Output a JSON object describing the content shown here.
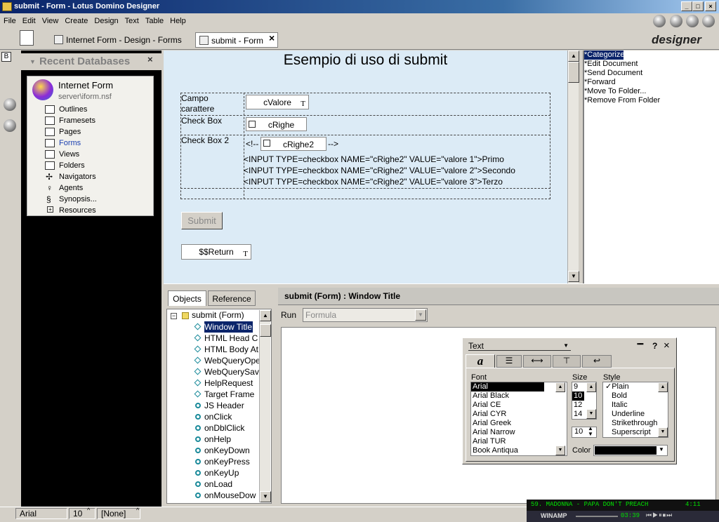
{
  "window": {
    "title": "submit - Form - Lotus Domino Designer",
    "min": "_",
    "max": "□",
    "close": "×"
  },
  "menu": [
    "File",
    "Edit",
    "View",
    "Create",
    "Design",
    "Text",
    "Table",
    "Help"
  ],
  "tabs": [
    {
      "label": "Internet Form - Design - Forms"
    },
    {
      "label": "submit - Form"
    }
  ],
  "tab_close": "×",
  "logo": "designer",
  "recent": {
    "title": "Recent Databases",
    "close": "×",
    "db_name": "Internet Form",
    "db_path": "server\\iform.nsf",
    "items": [
      "Outlines",
      "Framesets",
      "Pages",
      "Forms",
      "Views",
      "Folders",
      "Navigators",
      "Agents",
      "Synopsis...",
      "Resources"
    ]
  },
  "form": {
    "heading": "Esempio di uso di submit",
    "row1_label": "Campo\ncarattere",
    "row1_field": "cValore",
    "row2_label": "Check Box",
    "row2_field": "cRighe",
    "row3_label": "Check Box 2",
    "row3_open": "<!--",
    "row3_field": "cRighe2",
    "row3_close": "-->",
    "code1": "<INPUT TYPE=checkbox NAME=\"cRighe2\" VALUE=\"valore 1\">Primo",
    "code2": "<INPUT TYPE=checkbox NAME=\"cRighe2\" VALUE=\"valore 2\">Secondo",
    "code3": "<INPUT TYPE=checkbox NAME=\"cRighe2\" VALUE=\"valore 3\">Terzo",
    "submit": "Submit",
    "return_field": "$$Return",
    "field_t": "T"
  },
  "actions": [
    "*Categorize",
    "*Edit Document",
    "*Send Document",
    "*Forward",
    "*Move To Folder...",
    "*Remove From Folder"
  ],
  "objects": {
    "tab1": "Objects",
    "tab2": "Reference",
    "root": "submit (Form)",
    "items": [
      "Window Title",
      "HTML Head C",
      "HTML Body At",
      "WebQueryOpe",
      "WebQuerySav",
      "HelpRequest",
      "Target Frame",
      "JS Header",
      "onClick",
      "onDblClick",
      "onHelp",
      "onKeyDown",
      "onKeyPress",
      "onKeyUp",
      "onLoad",
      "onMouseDow"
    ]
  },
  "editor": {
    "header": "submit (Form) : Window Title",
    "run_label": "Run",
    "run_value": "Formula"
  },
  "text_palette": {
    "title": "Text",
    "font_label": "Font",
    "size_label": "Size",
    "style_label": "Style",
    "color_label": "Color",
    "fonts": [
      "Arial",
      "Arial Black",
      "Arial CE",
      "Arial CYR",
      "Arial Greek",
      "Arial Narrow",
      "Arial TUR",
      "Book Antiqua"
    ],
    "sizes": [
      "9",
      "10",
      "12",
      "14"
    ],
    "size_value": "10",
    "styles": [
      "Plain",
      "Bold",
      "Italic",
      "Underline",
      "Strikethrough",
      "Superscript"
    ],
    "check": "✓",
    "help": "?",
    "close": "×",
    "tab_a": "a",
    "color": "#000000"
  },
  "status": {
    "font": "Arial",
    "size": "10",
    "style": "[None]"
  },
  "winamp": {
    "track": "59. MADONNA - PAPA DON'T PREACH",
    "time": "4:11",
    "label": "WINAMP",
    "elapsed": "03:39"
  }
}
